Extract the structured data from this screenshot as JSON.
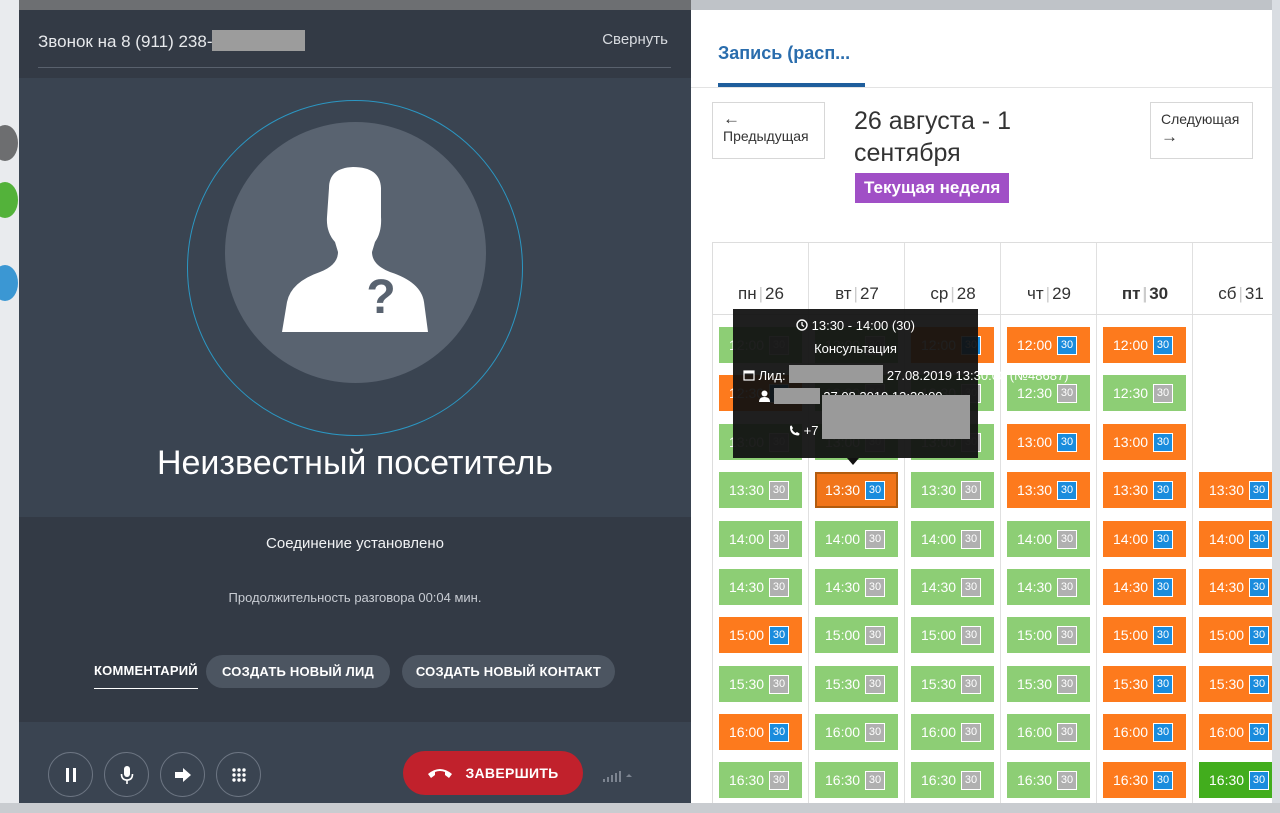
{
  "call": {
    "title_prefix": "Звонок на 8 (911) 238-",
    "collapse_label": "Свернуть",
    "visitor_name": "Неизвестный посетитель",
    "status": "Соединение установлено",
    "duration": "Продолжительность разговора 00:04 мин.",
    "tabs": {
      "comment": "КОММЕНТАРИЙ",
      "create_lead": "СОЗДАТЬ НОВЫЙ ЛИД",
      "create_contact": "СОЗДАТЬ НОВЫЙ КОНТАКТ"
    },
    "controls": {
      "end_label": "ЗАВЕРШИТЬ"
    }
  },
  "schedule": {
    "tab_label": "Запись (расп...",
    "prev_arrow": "←",
    "prev_label": "Предыдущая",
    "next_label": "Следующая",
    "next_arrow": "→",
    "week_range": "26 августа - 1 сентября",
    "current_week_badge": "Текущая неделя",
    "days": [
      {
        "name": "пн",
        "num": "26",
        "bold": false
      },
      {
        "name": "вт",
        "num": "27",
        "bold": false
      },
      {
        "name": "ср",
        "num": "28",
        "bold": false
      },
      {
        "name": "чт",
        "num": "29",
        "bold": false
      },
      {
        "name": "пт",
        "num": "30",
        "bold": true
      },
      {
        "name": "сб",
        "num": "31",
        "bold": false
      }
    ],
    "slots": [
      [
        {
          "time": "12:00",
          "dur": "30",
          "state": "green"
        },
        {
          "time": "12:30",
          "dur": "30",
          "state": "orange"
        },
        {
          "time": "13:00",
          "dur": "30",
          "state": "green"
        },
        {
          "time": "13:30",
          "dur": "30",
          "state": "green"
        },
        {
          "time": "14:00",
          "dur": "30",
          "state": "green"
        },
        {
          "time": "14:30",
          "dur": "30",
          "state": "green"
        },
        {
          "time": "15:00",
          "dur": "30",
          "state": "orange"
        },
        {
          "time": "15:30",
          "dur": "30",
          "state": "green"
        },
        {
          "time": "16:00",
          "dur": "30",
          "state": "orange"
        },
        {
          "time": "16:30",
          "dur": "30",
          "state": "green"
        }
      ],
      [
        {
          "time": "12:00",
          "dur": "30",
          "state": "green"
        },
        {
          "time": "12:30",
          "dur": "30",
          "state": "green"
        },
        {
          "time": "13:00",
          "dur": "30",
          "state": "green"
        },
        {
          "time": "13:30",
          "dur": "30",
          "state": "orange",
          "selected": true
        },
        {
          "time": "14:00",
          "dur": "30",
          "state": "green"
        },
        {
          "time": "14:30",
          "dur": "30",
          "state": "green"
        },
        {
          "time": "15:00",
          "dur": "30",
          "state": "green"
        },
        {
          "time": "15:30",
          "dur": "30",
          "state": "green"
        },
        {
          "time": "16:00",
          "dur": "30",
          "state": "green"
        },
        {
          "time": "16:30",
          "dur": "30",
          "state": "green"
        }
      ],
      [
        {
          "time": "12:00",
          "dur": "30",
          "state": "orange"
        },
        {
          "time": "12:30",
          "dur": "30",
          "state": "green"
        },
        {
          "time": "13:00",
          "dur": "30",
          "state": "green"
        },
        {
          "time": "13:30",
          "dur": "30",
          "state": "green"
        },
        {
          "time": "14:00",
          "dur": "30",
          "state": "green"
        },
        {
          "time": "14:30",
          "dur": "30",
          "state": "green"
        },
        {
          "time": "15:00",
          "dur": "30",
          "state": "green"
        },
        {
          "time": "15:30",
          "dur": "30",
          "state": "green"
        },
        {
          "time": "16:00",
          "dur": "30",
          "state": "green"
        },
        {
          "time": "16:30",
          "dur": "30",
          "state": "green"
        }
      ],
      [
        {
          "time": "12:00",
          "dur": "30",
          "state": "orange"
        },
        {
          "time": "12:30",
          "dur": "30",
          "state": "green"
        },
        {
          "time": "13:00",
          "dur": "30",
          "state": "orange"
        },
        {
          "time": "13:30",
          "dur": "30",
          "state": "orange"
        },
        {
          "time": "14:00",
          "dur": "30",
          "state": "green"
        },
        {
          "time": "14:30",
          "dur": "30",
          "state": "green"
        },
        {
          "time": "15:00",
          "dur": "30",
          "state": "green"
        },
        {
          "time": "15:30",
          "dur": "30",
          "state": "green"
        },
        {
          "time": "16:00",
          "dur": "30",
          "state": "green"
        },
        {
          "time": "16:30",
          "dur": "30",
          "state": "green"
        }
      ],
      [
        {
          "time": "12:00",
          "dur": "30",
          "state": "orange"
        },
        {
          "time": "12:30",
          "dur": "30",
          "state": "green"
        },
        {
          "time": "13:00",
          "dur": "30",
          "state": "orange"
        },
        {
          "time": "13:30",
          "dur": "30",
          "state": "orange"
        },
        {
          "time": "14:00",
          "dur": "30",
          "state": "orange"
        },
        {
          "time": "14:30",
          "dur": "30",
          "state": "orange"
        },
        {
          "time": "15:00",
          "dur": "30",
          "state": "orange"
        },
        {
          "time": "15:30",
          "dur": "30",
          "state": "orange"
        },
        {
          "time": "16:00",
          "dur": "30",
          "state": "orange"
        },
        {
          "time": "16:30",
          "dur": "30",
          "state": "orange"
        }
      ],
      [
        null,
        null,
        null,
        {
          "time": "13:30",
          "dur": "30",
          "state": "orange"
        },
        {
          "time": "14:00",
          "dur": "30",
          "state": "orange"
        },
        {
          "time": "14:30",
          "dur": "30",
          "state": "orange"
        },
        {
          "time": "15:00",
          "dur": "30",
          "state": "orange"
        },
        {
          "time": "15:30",
          "dur": "30",
          "state": "orange"
        },
        {
          "time": "16:00",
          "dur": "30",
          "state": "orange"
        },
        {
          "time": "16:30",
          "dur": "30",
          "state": "darkgreen"
        }
      ]
    ],
    "tooltip": {
      "time_range": "13:30 - 14:00 (30)",
      "service": "Консультация",
      "lead_label": "Лид:",
      "lead_suffix": "27.08.2019 13:30:00 (№48687)",
      "client_suffix": "27.08.2019 13:30:00",
      "phone_prefix": "+7"
    }
  },
  "colors": {
    "free_slot": "#8dce75",
    "busy_slot": "#fd7a1d",
    "end_call": "#c1212c",
    "current_week": "#a04fc6",
    "accent_blue": "#2a6dad"
  }
}
